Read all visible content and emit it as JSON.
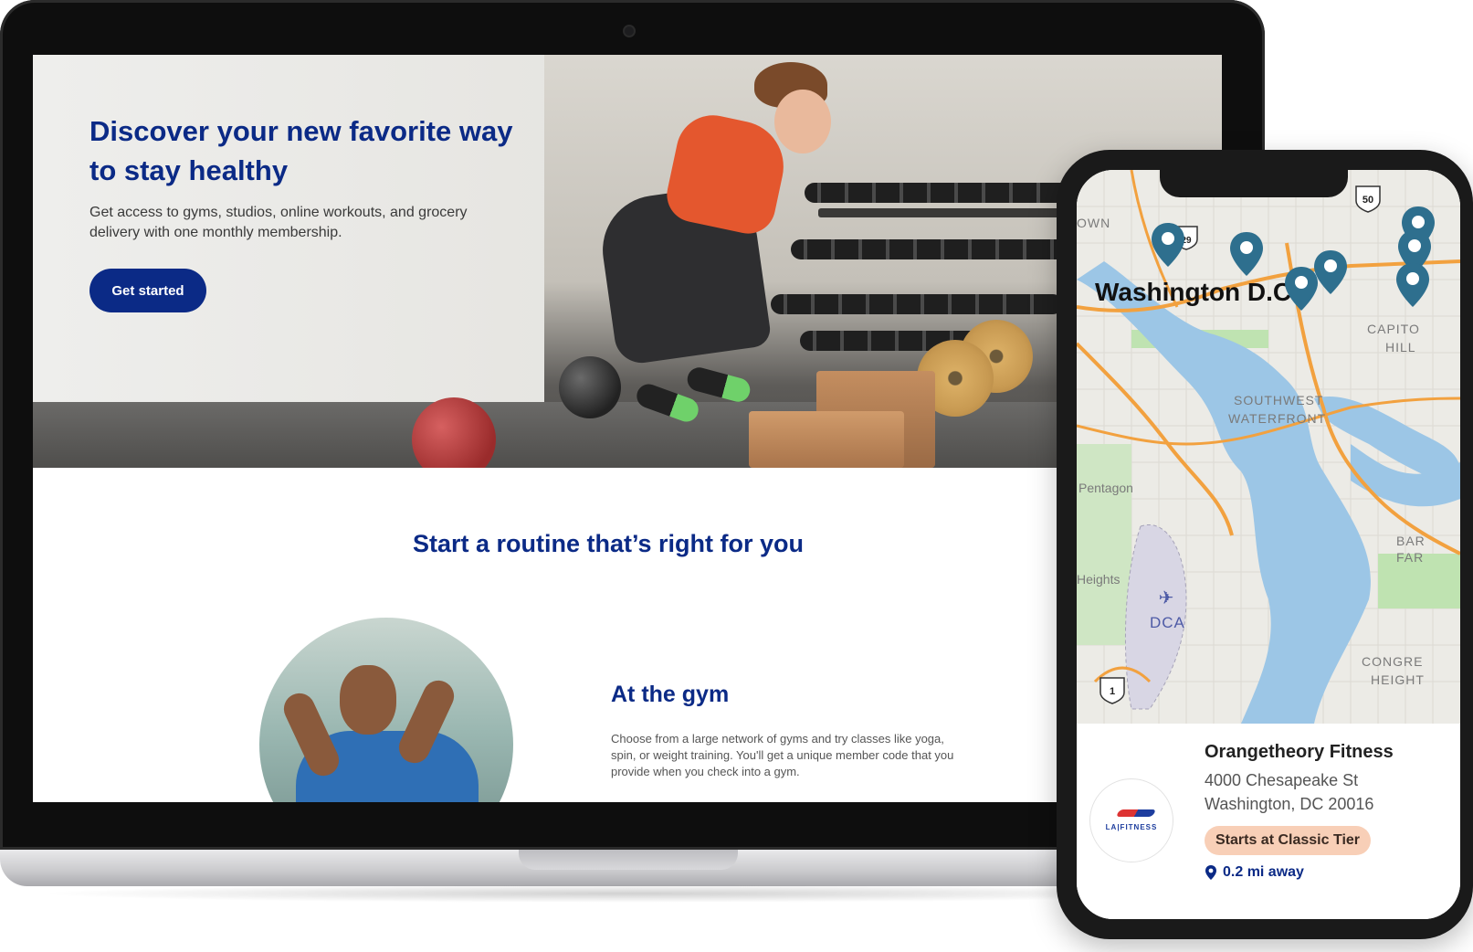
{
  "hero": {
    "title": "Discover your new favorite way to stay healthy",
    "subtitle": "Get access to gyms, studios, online workouts, and grocery delivery with one monthly membership.",
    "cta_label": "Get started"
  },
  "routine": {
    "title": "Start a routine that’s right for you"
  },
  "at_the_gym": {
    "heading": "At the gym",
    "description": "Choose from a large network of gyms and try classes like yoga, spin, or weight training. You'll get a unique member code that you provide when you check into a gym."
  },
  "map": {
    "city_label": "Washington D.C",
    "labels": [
      "OWN",
      "CAPITO",
      "HILL",
      "SOUTHWEST",
      "WATERFRONT",
      "Pentagon",
      "Heights",
      "DCA",
      "BAR",
      "FAR",
      "CONGRE",
      "HEIGHT"
    ],
    "route_shields": [
      "50",
      "29",
      "1"
    ],
    "pin_count": 7
  },
  "listing": {
    "name": "Orangetheory Fitness",
    "address_line1": "4000 Chesapeake St",
    "address_line2": "Washington, DC 20016",
    "tier_badge": "Starts at Classic Tier",
    "distance": "0.2 mi away",
    "logo_text": "LA|FITNESS"
  },
  "colors": {
    "brand_navy": "#0b2a86",
    "badge_peach": "#f8cfb7",
    "map_water": "#9cc6e6",
    "map_road": "#f2a13f",
    "map_pin": "#2e6f8e"
  }
}
